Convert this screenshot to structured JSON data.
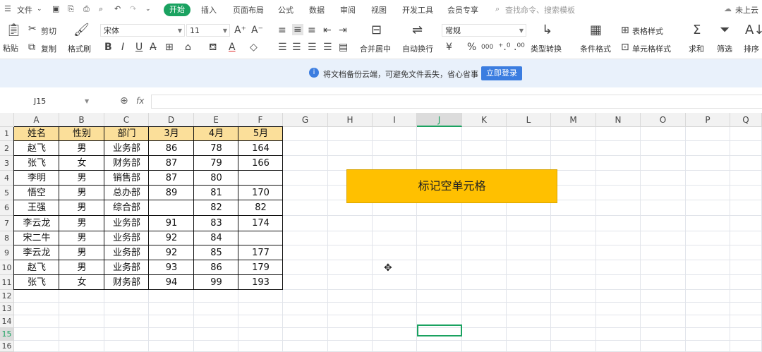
{
  "menubar": {
    "hamburger_label": "文件",
    "items": [
      "开始",
      "插入",
      "页面布局",
      "公式",
      "数据",
      "审阅",
      "视图",
      "开发工具",
      "会员专享"
    ],
    "search_placeholder": "查找命令、搜索模板",
    "right_label": "未上云"
  },
  "ribbon": {
    "clipboard": {
      "paste": "粘贴",
      "cut": "剪切",
      "copy": "复制",
      "format_painter": "格式刷"
    },
    "font": {
      "name": "宋体",
      "size": "11",
      "bold": "B",
      "italic": "I",
      "underline": "U"
    },
    "alignment": {
      "merge": "合并居中",
      "wrap": "自动换行"
    },
    "number": {
      "format": "常规",
      "currency": "¥",
      "percent": "%",
      "thousands": "000",
      "convert": "类型转换"
    },
    "styles": {
      "conditional": "条件格式",
      "table_style": "表格样式",
      "cell_style": "单元格样式"
    },
    "editing": {
      "sum": "求和",
      "filter": "筛选",
      "sort": "排序"
    }
  },
  "notice": {
    "text": "将文档备份云端，可避免文件丢失，省心省事",
    "button": "立即登录"
  },
  "formula_bar": {
    "cell_ref": "J15",
    "fx": "fx",
    "value": ""
  },
  "columns": [
    "A",
    "B",
    "C",
    "D",
    "E",
    "F",
    "G",
    "H",
    "I",
    "J",
    "K",
    "L",
    "M",
    "N",
    "O",
    "P",
    "Q"
  ],
  "selected_column": "J",
  "rows": [
    "1",
    "2",
    "3",
    "4",
    "5",
    "6",
    "7",
    "8",
    "9",
    "10",
    "11",
    "12",
    "13",
    "14",
    "15",
    "16"
  ],
  "selected_row": "15",
  "table": {
    "headers": [
      "姓名",
      "性别",
      "部门",
      "3月",
      "4月",
      "5月"
    ],
    "rows": [
      [
        "赵飞",
        "男",
        "业务部",
        "86",
        "78",
        "164"
      ],
      [
        "张飞",
        "女",
        "财务部",
        "87",
        "79",
        "166"
      ],
      [
        "李明",
        "男",
        "销售部",
        "87",
        "80",
        ""
      ],
      [
        "悟空",
        "男",
        "总办部",
        "89",
        "81",
        "170"
      ],
      [
        "王强",
        "男",
        "综合部",
        "",
        "82",
        "82"
      ],
      [
        "李云龙",
        "男",
        "业务部",
        "91",
        "83",
        "174"
      ],
      [
        "宋二牛",
        "男",
        "业务部",
        "92",
        "84",
        ""
      ],
      [
        "李云龙",
        "男",
        "业务部",
        "92",
        "85",
        "177"
      ],
      [
        "赵飞",
        "男",
        "业务部",
        "93",
        "86",
        "179"
      ],
      [
        "张飞",
        "女",
        "财务部",
        "94",
        "99",
        "193"
      ]
    ]
  },
  "mark_button": "标记空单元格",
  "colors": {
    "accent": "#1aa260",
    "header_fill": "#fbdf9a",
    "button_fill": "#ffc000",
    "notice_bg": "#e9f1fb",
    "login_btn": "#3b7de0"
  }
}
